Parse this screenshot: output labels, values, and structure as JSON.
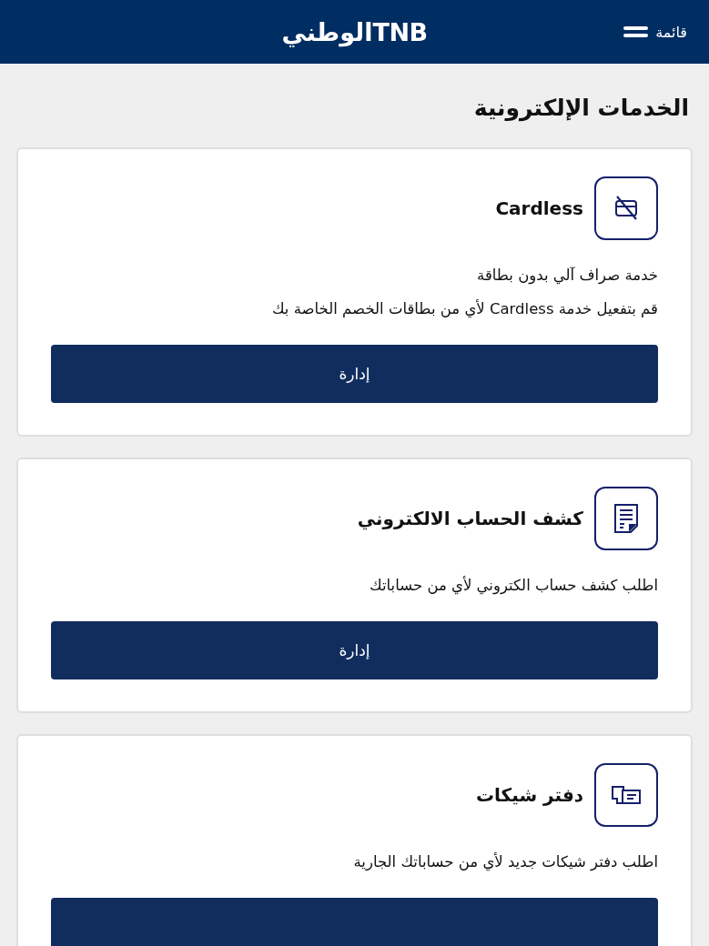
{
  "header": {
    "logo_latin": "TNB",
    "logo_arabic": "الوطني",
    "menu_label": "قائمة"
  },
  "page_title": "الخدمات الإلكترونية",
  "cards": [
    {
      "kind": "cardless",
      "title": "Cardless",
      "descriptions": [
        "خدمة صراف آلي بدون بطاقة",
        "قم بتفعيل خدمة Cardless لأي من بطاقات الخصم الخاصة بك"
      ],
      "has_button": true,
      "button_label": "إدارة"
    },
    {
      "kind": "statement",
      "title": "كشف الحساب الالكتروني",
      "descriptions": [
        "اطلب كشف حساب الكتروني لأي من حساباتك"
      ],
      "has_button": true,
      "button_label": "إدارة"
    },
    {
      "kind": "chequebook",
      "title": "دفتر شيكات",
      "descriptions": [
        "اطلب دفتر شيكات جديد لأي من حساباتك الجارية"
      ],
      "has_button": true
    }
  ]
}
